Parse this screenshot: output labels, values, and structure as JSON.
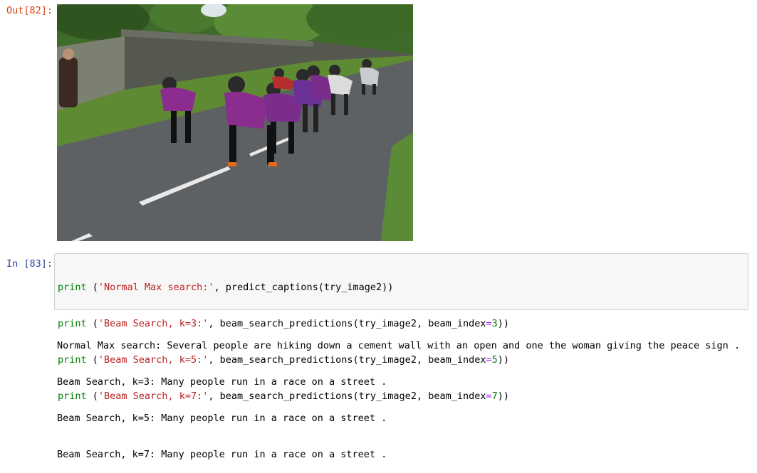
{
  "out_cell": {
    "prompt": "Out[82]:"
  },
  "in_cell": {
    "prompt": "In [83]:",
    "code_lines": [
      {
        "fn": "print",
        "open": " (",
        "str": "'Normal Max search:'",
        "rest_a": ", predict_captions(try_image2))",
        "kwarg": "",
        "eq": "",
        "num": "",
        "close": ""
      },
      {
        "fn": "print",
        "open": " (",
        "str": "'Beam Search, k=3:'",
        "rest_a": ", beam_search_predictions(try_image2, ",
        "kwarg": "beam_index",
        "eq": "=",
        "num": "3",
        "close": "))"
      },
      {
        "fn": "print",
        "open": " (",
        "str": "'Beam Search, k=5:'",
        "rest_a": ", beam_search_predictions(try_image2, ",
        "kwarg": "beam_index",
        "eq": "=",
        "num": "5",
        "close": "))"
      },
      {
        "fn": "print",
        "open": " (",
        "str": "'Beam Search, k=7:'",
        "rest_a": ", beam_search_predictions(try_image2, ",
        "kwarg": "beam_index",
        "eq": "=",
        "num": "7",
        "close": "))"
      }
    ]
  },
  "stdout_lines": [
    "Normal Max search: Several people are hiking down a cement wall with an open and one the woman giving the peace sign .",
    "Beam Search, k=3: Many people run in a race on a street .",
    "Beam Search, k=5: Many people run in a race on a street .",
    "Beam Search, k=7: Many people run in a race on a street ."
  ],
  "colors": {
    "out_prompt": "#d84315",
    "in_prompt": "#303f9f",
    "keyword": "#008000",
    "string": "#ba2121",
    "operator": "#aa22ff",
    "input_background": "#f7f7f7",
    "input_border": "#cfcfcf"
  }
}
